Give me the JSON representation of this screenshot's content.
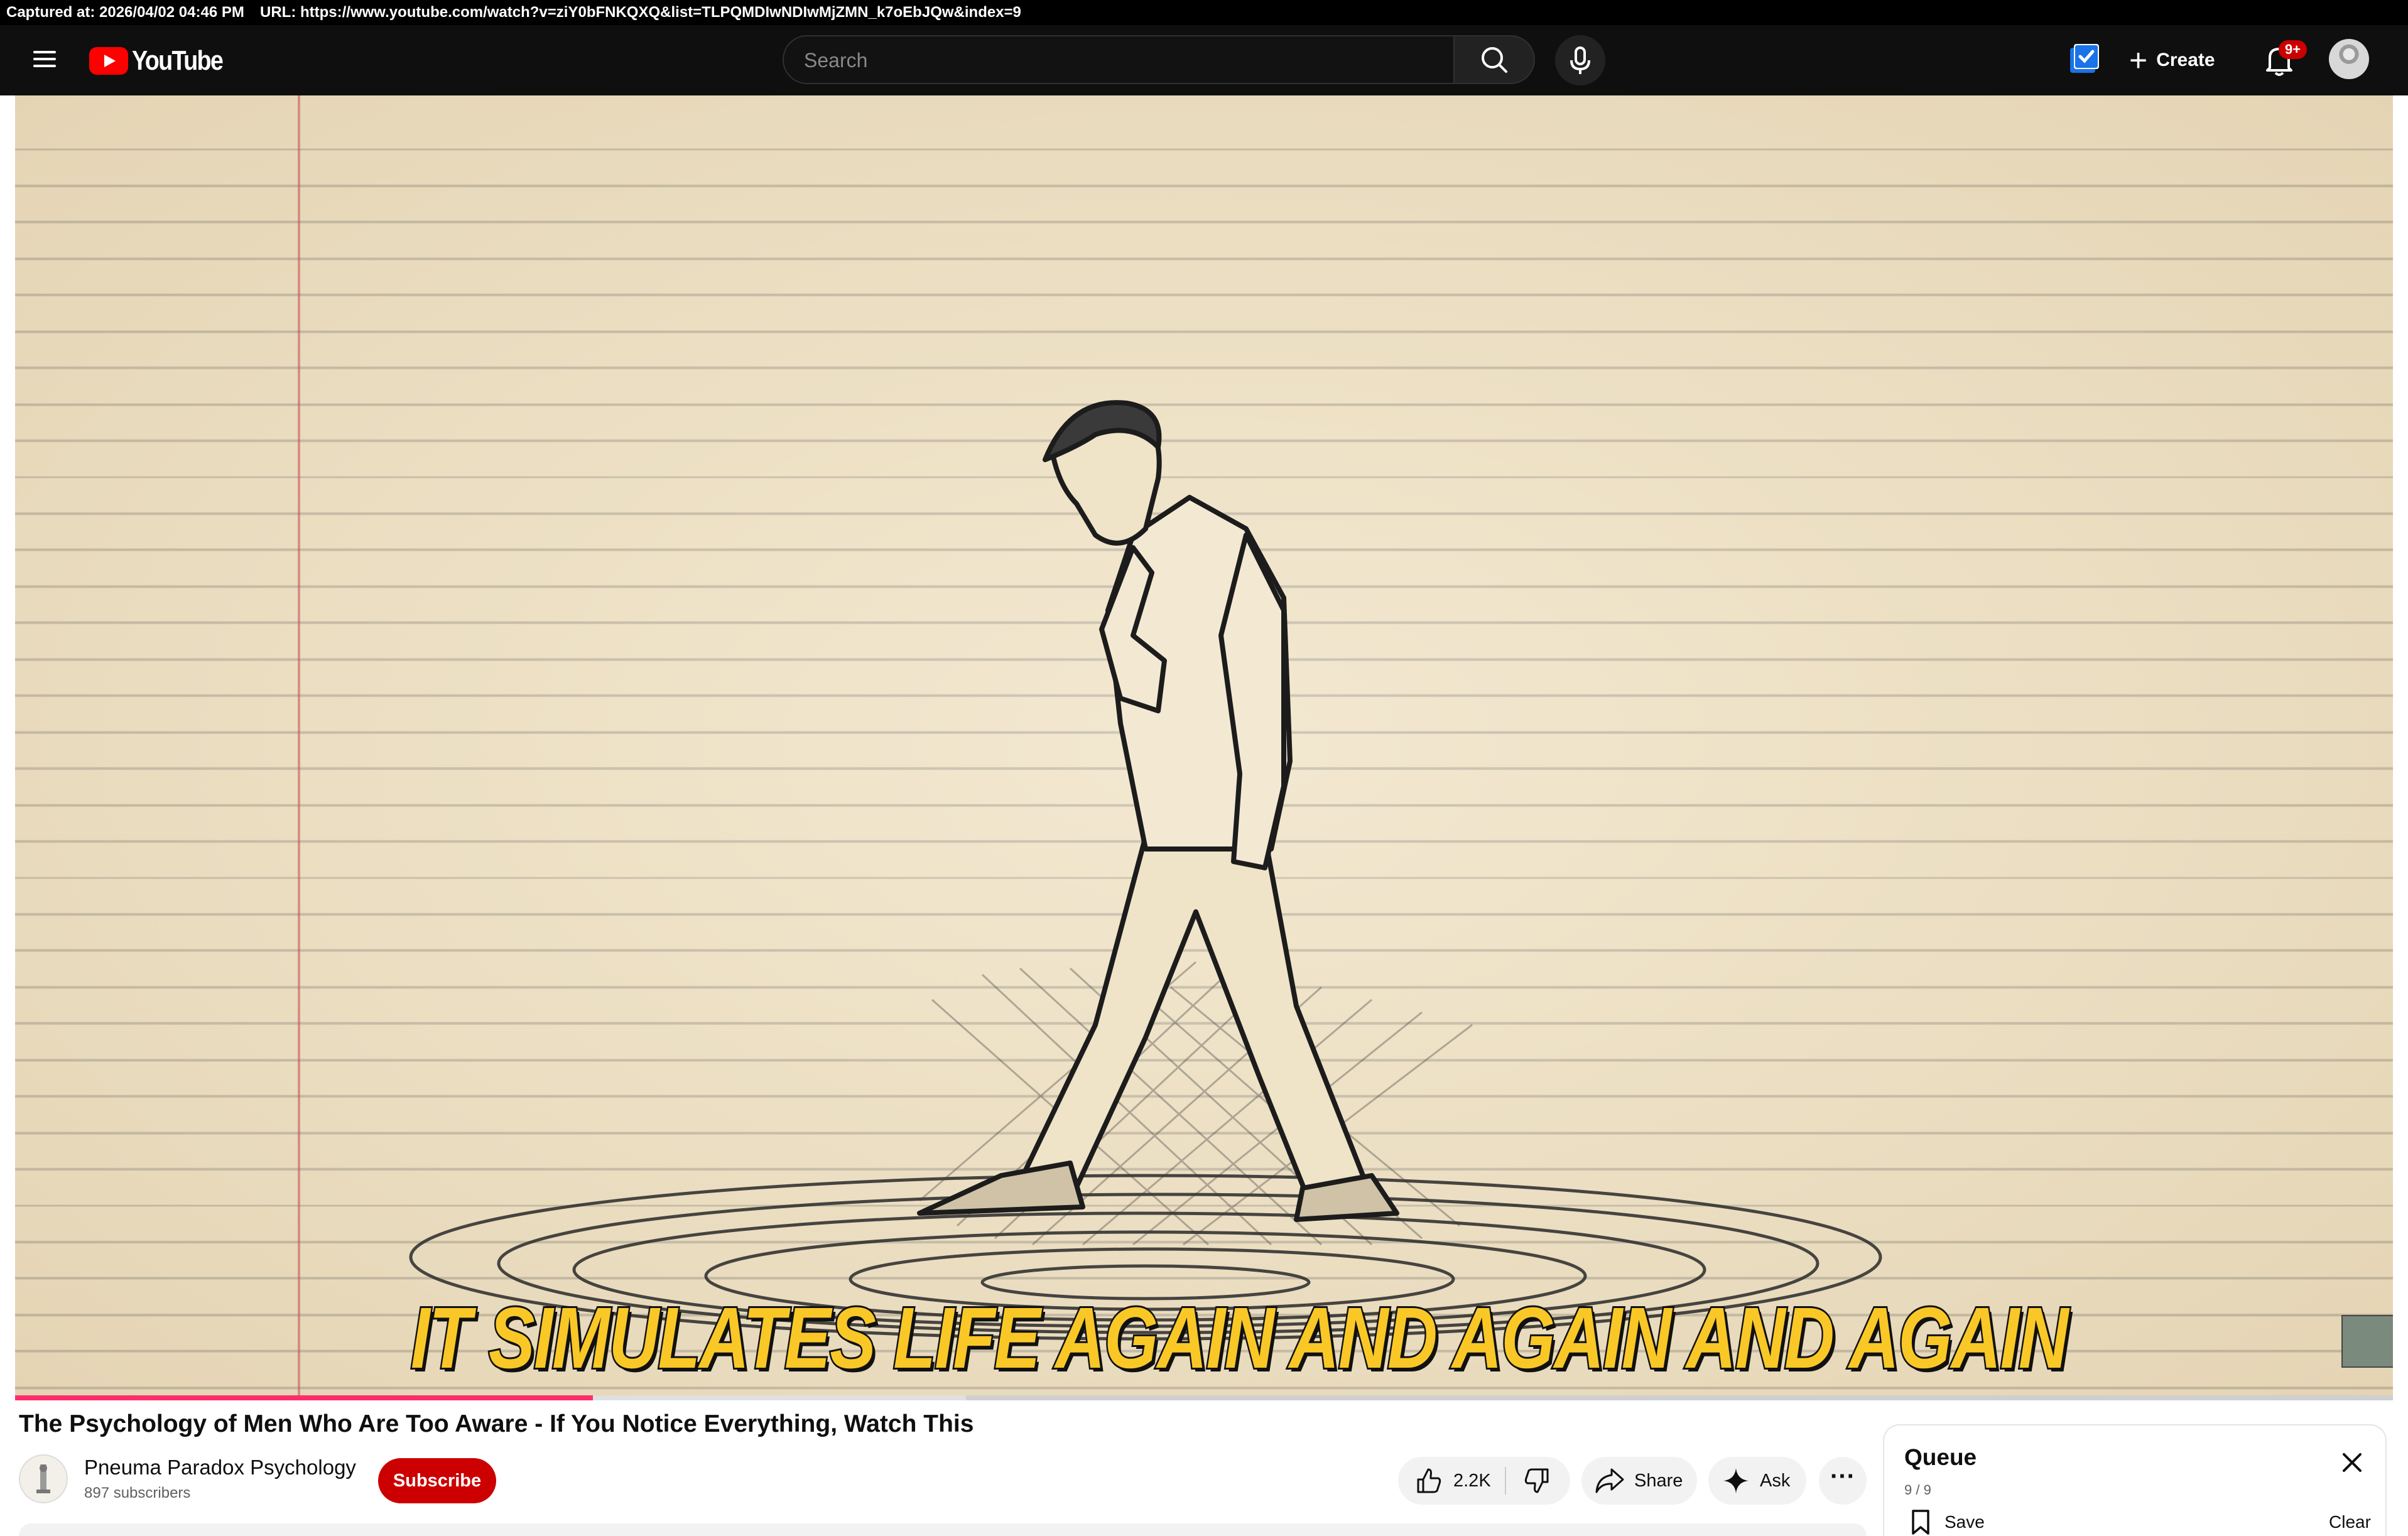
{
  "capture": {
    "captured_at": "Captured at: 2026/04/02 04:46 PM",
    "url": "URL: https://www.youtube.com/watch?v=ziY0bFNKQXQ&list=TLPQMDIwNDIwMjZMN_k7oEbJQw&index=9"
  },
  "header": {
    "logo_text": "YouTube",
    "search_placeholder": "Search",
    "create_label": "Create",
    "notification_badge": "9+"
  },
  "video": {
    "caption": "IT SIMULATES LIFE AGAIN AND AGAIN AND AGAIN",
    "progress_played_fraction": 0.243,
    "progress_buffered_fraction": 0.4,
    "title": "The Psychology of Men Who Are Too Aware - If You Notice Everything, Watch This"
  },
  "channel": {
    "name": "Pneuma Paradox Psychology",
    "subscribers": "897 subscribers",
    "subscribe_label": "Subscribe"
  },
  "actions": {
    "likes": "2.2K",
    "share_label": "Share",
    "ask_label": "Ask"
  },
  "queue": {
    "title": "Queue",
    "count": "9 / 9",
    "save_label": "Save",
    "clear_label": "Clear"
  },
  "colors": {
    "youtube_red": "#ff0000",
    "subscribe_red": "#cc0000",
    "progress": "#ff2d6c",
    "caption_yellow": "#f9c827"
  }
}
